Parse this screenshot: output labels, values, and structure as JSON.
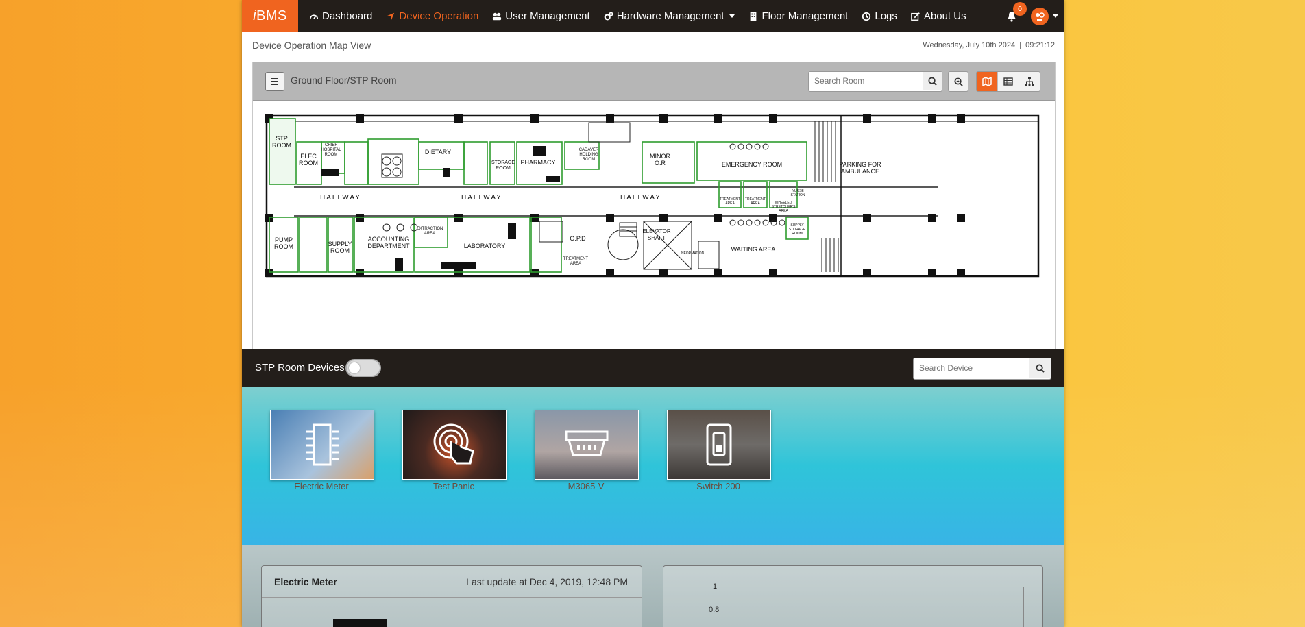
{
  "nav": {
    "brand_prefix": "i",
    "brand_rest": "BMS",
    "items": [
      {
        "label": "Dashboard",
        "icon": "dashboard-icon"
      },
      {
        "label": "Device Operation",
        "icon": "location-arrow-icon",
        "active": true
      },
      {
        "label": "User Management",
        "icon": "users-icon"
      },
      {
        "label": "Hardware Management",
        "icon": "cogs-icon",
        "dropdown": true
      },
      {
        "label": "Floor Management",
        "icon": "building-icon"
      },
      {
        "label": "Logs",
        "icon": "history-icon"
      },
      {
        "label": "About Us",
        "icon": "edit-icon"
      }
    ],
    "notification_count": "0",
    "accent": "#f0641f",
    "bar_color": "#231e1a"
  },
  "page": {
    "title": "Device Operation Map View",
    "date": "Wednesday, July 10th 2024",
    "time": "09:21:12"
  },
  "map": {
    "breadcrumb": "Ground Floor/STP Room",
    "search_placeholder": "Search Room",
    "room_labels": {
      "stp": [
        "STP",
        "ROOM"
      ],
      "elec": [
        "ELEC",
        "ROOM"
      ],
      "chief": [
        "CHIEF",
        "HOSPITAL",
        "ROOM"
      ],
      "dietary": "DIETARY",
      "storage": [
        "STORAGE",
        "ROOM"
      ],
      "pharmacy": "PHARMACY",
      "cadaver": [
        "CADAVER",
        "HOLDING",
        "ROOM"
      ],
      "minor": [
        "MINOR",
        "O.R"
      ],
      "emergency": "EMERGENCY ROOM",
      "parking": [
        "PARKING FOR",
        "AMBULANCE"
      ],
      "hallway": "HALLWAY",
      "pump": [
        "PUMP",
        "ROOM"
      ],
      "supply": [
        "SUPPLY",
        "ROOM"
      ],
      "accounting": [
        "ACCOUNTING",
        "DEPARTMENT"
      ],
      "extraction": [
        "EXTRACTION",
        "AREA"
      ],
      "laboratory": "LABORATORY",
      "opd": "O.P.D",
      "treatment_small": [
        "TREATMENT",
        "AREA"
      ],
      "elevator": [
        "ELEVATOR",
        "SHAFT"
      ],
      "information": "INFORMATION",
      "waiting": "WAITING AREA",
      "treatment_a": [
        "TREATMENT",
        "AREA"
      ],
      "treatment_b": [
        "TREATMENT",
        "AREA"
      ],
      "wheeled": [
        "WHEELED",
        "STRETCHER'S",
        "AREA"
      ],
      "nurse": [
        "NURSE",
        "STATION"
      ],
      "supply_storage": [
        "SUPPLY",
        "STORAGE",
        "ROOM"
      ]
    }
  },
  "devices": {
    "title": "STP Room Devices",
    "search_placeholder": "Search Device",
    "items": [
      {
        "label": "Electric Meter",
        "icon": "chip-icon"
      },
      {
        "label": "Test Panic",
        "icon": "touch-icon"
      },
      {
        "label": "M3065-V",
        "icon": "sensor-icon"
      },
      {
        "label": "Switch 200",
        "icon": "switch-icon"
      }
    ]
  },
  "card": {
    "title": "Electric Meter",
    "last_update": "Last update at Dec 4, 2019, 12:48 PM"
  },
  "chart": {
    "ticks": [
      "1",
      "0.8"
    ]
  }
}
